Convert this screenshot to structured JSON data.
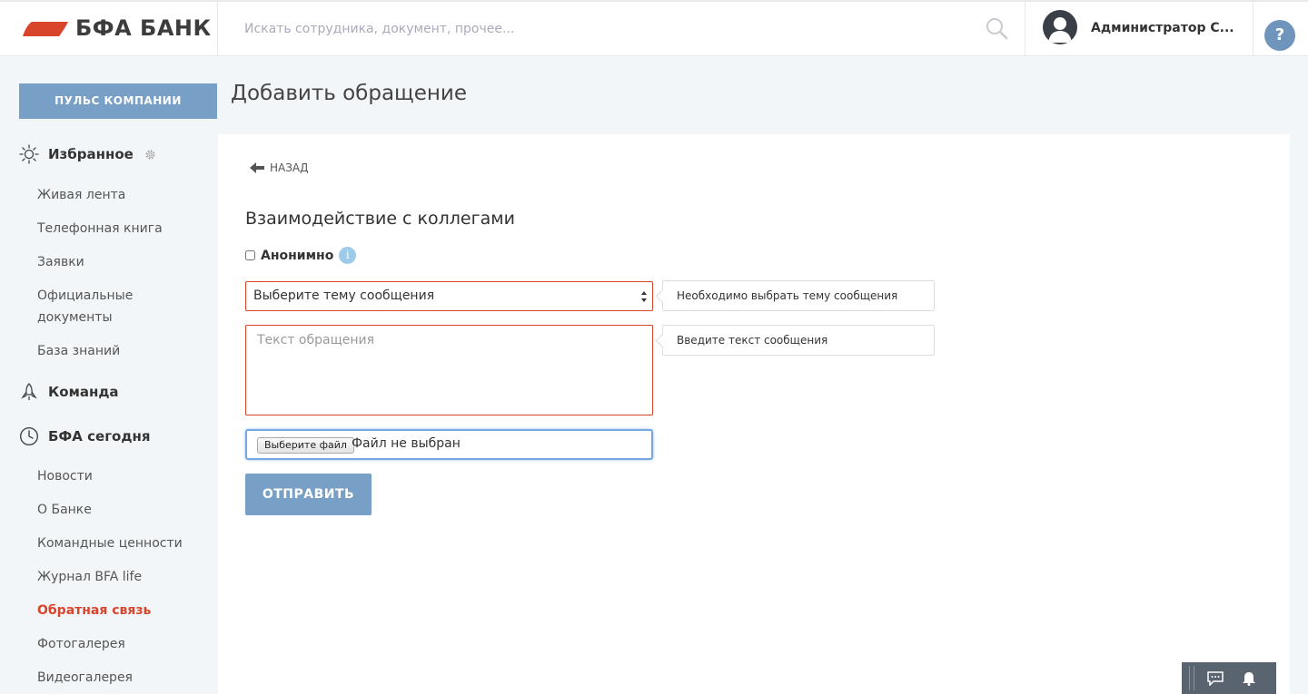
{
  "header": {
    "logo_text": "БФА БАНК",
    "search_placeholder": "Искать сотрудника, документ, прочее...",
    "user_name": "Администратор С...",
    "help_label": "?"
  },
  "sidebar": {
    "pulse_label": "ПУЛЬС КОМПАНИИ",
    "favorites_title": "Избранное",
    "favorites_items": [
      "Живая лента",
      "Телефонная книга",
      "Заявки",
      "Официальные",
      "документы",
      "База знаний"
    ],
    "team_title": "Команда",
    "today_title": "БФА сегодня",
    "today_items": [
      "Новости",
      "О Банке",
      "Командные ценности",
      "Журнал BFA life",
      "Обратная связь",
      "Фотогалерея",
      "Видеогалерея"
    ]
  },
  "main": {
    "page_title": "Добавить обращение",
    "back_label": "НАЗАД",
    "form_title": "Взаимодействие с коллегами",
    "anonymous_label": "Анонимно",
    "info_label": "i",
    "topic_select_value": "Выберите тему сообщения",
    "topic_hint": "Необходимо выбрать тему сообщения",
    "message_placeholder": "Текст обращения",
    "message_hint": "Введите текст сообщения",
    "file_button_label": "Выберите файл",
    "file_status": "Файл не выбран",
    "submit_label": "ОТПРАВИТЬ"
  },
  "colors": {
    "accent": "#789fc6",
    "error": "#d9442c",
    "active_nav": "#d9442c",
    "logo_red": "#d9442c"
  }
}
